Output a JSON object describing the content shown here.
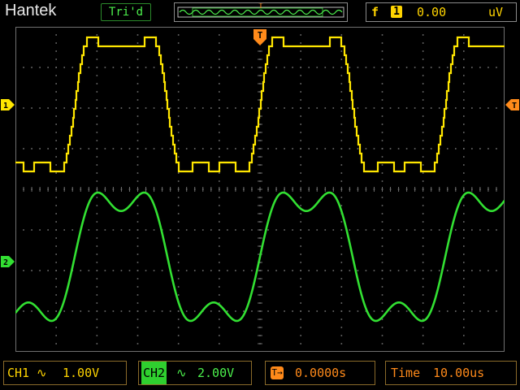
{
  "header": {
    "brand": "Hantek",
    "trigger_status": "Tri'd",
    "trigger_function_icon": "f",
    "trigger_source": "1",
    "trigger_level": "0.00",
    "trigger_level_unit": "uV"
  },
  "markers": {
    "trigger_time": "T",
    "trigger_level_side": "T",
    "ch1_marker": "1",
    "ch2_marker": "2"
  },
  "footer": {
    "ch1_label": "CH1",
    "ch1_scale": "1.00V",
    "ch2_label": "CH2",
    "ch2_scale": "2.00V",
    "trigger_position": "0.0000s",
    "timebase_label": "Time",
    "timebase_value": "10.00us"
  },
  "colors": {
    "ch1": "#ffe600",
    "ch2": "#32e032",
    "trigger": "#ff8a1a",
    "grid": "#6a6a6a"
  }
}
